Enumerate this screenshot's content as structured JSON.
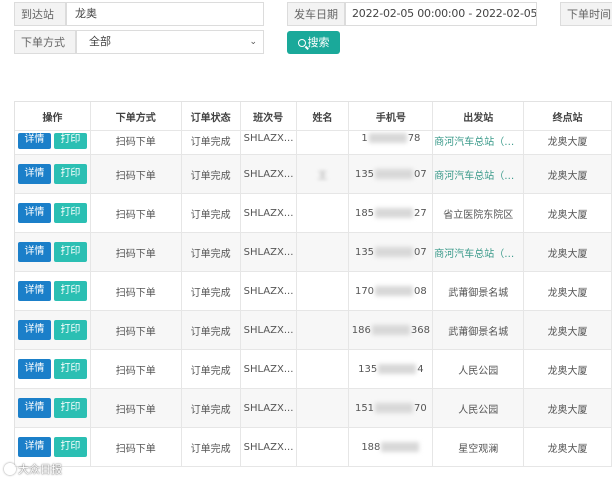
{
  "filters": {
    "arrival_label": "到达站",
    "arrival_value": "龙奥",
    "date_label": "发车日期",
    "date_value": "2022-02-05 00:00:00 - 2022-02-05 2",
    "order_time_label": "下单时间",
    "order_method_label": "下单方式",
    "order_method_value": "全部",
    "search_label": "搜索"
  },
  "table": {
    "columns": [
      "操作",
      "下单方式",
      "订单状态",
      "班次号",
      "姓名",
      "手机号",
      "出发站",
      "终点站"
    ],
    "detail_label": "详情",
    "print_label": "打印",
    "rows": [
      {
        "method": "扫码下单",
        "status": "订单完成",
        "trip": "SHLAZX...",
        "name": "",
        "phone_a": "1",
        "phone_b": "78",
        "from": "商河汽车总站（西...",
        "to": "龙奥大厦"
      },
      {
        "method": "扫码下单",
        "status": "订单完成",
        "trip": "SHLAZX...",
        "name": "王",
        "phone_a": "135",
        "phone_b": "07",
        "from": "商河汽车总站（西...",
        "to": "龙奥大厦"
      },
      {
        "method": "扫码下单",
        "status": "订单完成",
        "trip": "SHLAZX...",
        "name": "",
        "phone_a": "185",
        "phone_b": "27",
        "from": "省立医院东院区",
        "to": "龙奥大厦"
      },
      {
        "method": "扫码下单",
        "status": "订单完成",
        "trip": "SHLAZX...",
        "name": "",
        "phone_a": "135",
        "phone_b": "07",
        "from": "商河汽车总站（西...",
        "to": "龙奥大厦"
      },
      {
        "method": "扫码下单",
        "status": "订单完成",
        "trip": "SHLAZX...",
        "name": "",
        "phone_a": "170",
        "phone_b": "08",
        "from": "武莆御景名城",
        "to": "龙奥大厦"
      },
      {
        "method": "扫码下单",
        "status": "订单完成",
        "trip": "SHLAZX...",
        "name": "",
        "phone_a": "186",
        "phone_b": "368",
        "from": "武莆御景名城",
        "to": "龙奥大厦"
      },
      {
        "method": "扫码下单",
        "status": "订单完成",
        "trip": "SHLAZX...",
        "name": "",
        "phone_a": "135",
        "phone_b": "4",
        "from": "人民公园",
        "to": "龙奥大厦"
      },
      {
        "method": "扫码下单",
        "status": "订单完成",
        "trip": "SHLAZX...",
        "name": "",
        "phone_a": "151",
        "phone_b": "70",
        "from": "人民公园",
        "to": "龙奥大厦"
      },
      {
        "method": "扫码下单",
        "status": "订单完成",
        "trip": "SHLAZX...",
        "name": "",
        "phone_a": "188",
        "phone_b": "",
        "from": "星空观澜",
        "to": "龙奥大厦"
      }
    ]
  },
  "watermark": "大众日报",
  "colors": {
    "teal": "#1aa99a",
    "detail_blue": "#1b7fc9",
    "print_teal": "#2bbfb3",
    "station_link": "#3a9a8a"
  }
}
